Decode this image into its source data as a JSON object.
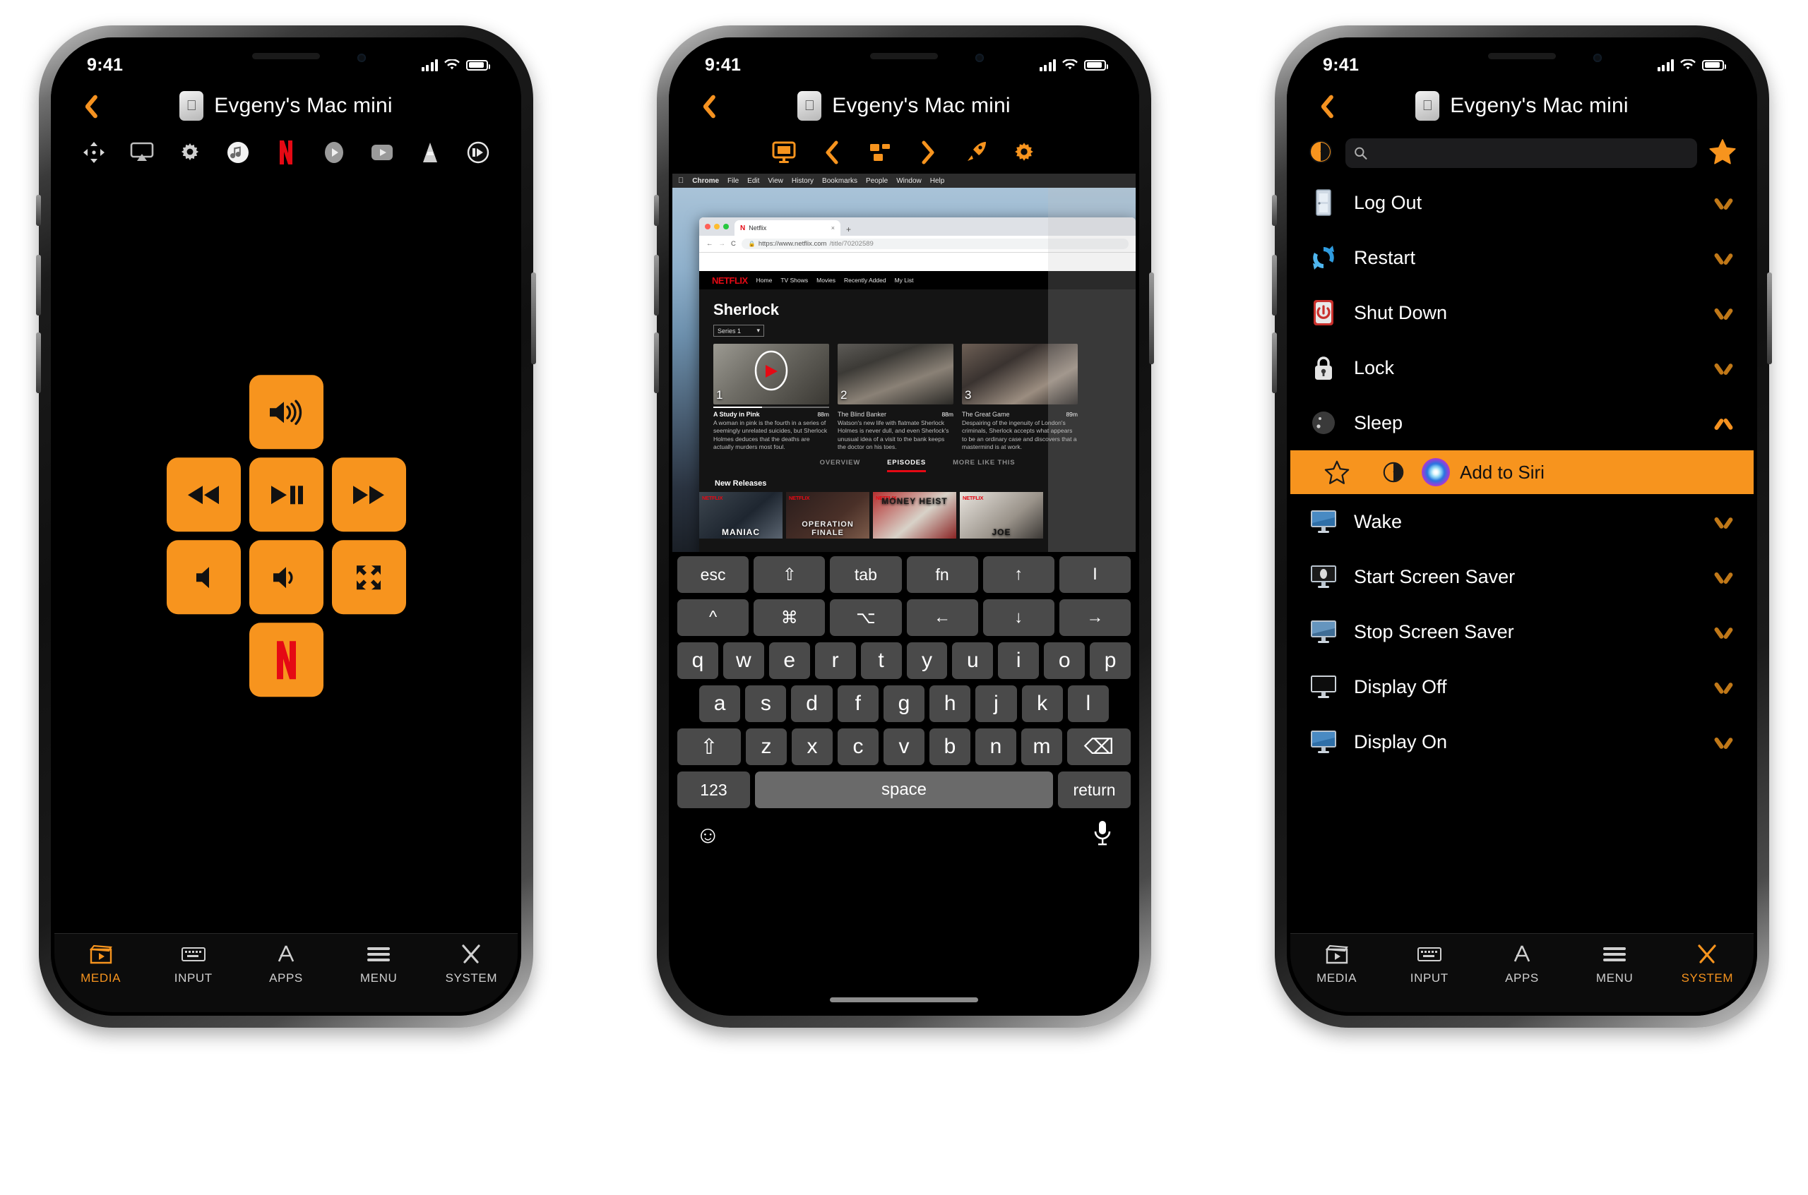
{
  "status": {
    "time": "9:41",
    "signal_bars": 4,
    "wifi": "wifi-icon",
    "battery": "battery-icon"
  },
  "nav": {
    "back": "back-chevron",
    "device_icon": "mac-mini-icon",
    "title": "Evgeny's Mac mini"
  },
  "phone1": {
    "toolbar": [
      {
        "name": "move-cursor-icon",
        "label": "Move"
      },
      {
        "name": "airplay-icon",
        "label": "AirPlay"
      },
      {
        "name": "gear-icon",
        "label": "Settings"
      },
      {
        "name": "itunes-icon",
        "label": "iTunes"
      },
      {
        "name": "netflix-icon",
        "label": "Netflix"
      },
      {
        "name": "quicktime-icon",
        "label": "QuickTime"
      },
      {
        "name": "youtube-icon",
        "label": "YouTube"
      },
      {
        "name": "vlc-icon",
        "label": "VLC"
      },
      {
        "name": "player-icon",
        "label": "Player"
      }
    ],
    "pad": {
      "top": {
        "name": "volume-up-icon",
        "label": "Volume Up"
      },
      "left": {
        "name": "rewind-icon",
        "label": "Rewind"
      },
      "center": {
        "name": "play-pause-icon",
        "label": "Play / Pause"
      },
      "right": {
        "name": "fast-forward-icon",
        "label": "Fast Forward"
      },
      "bottom_left": {
        "name": "mute-icon",
        "label": "Mute"
      },
      "bottom_center": {
        "name": "volume-down-icon",
        "label": "Volume Down"
      },
      "bottom_right": {
        "name": "fullscreen-icon",
        "label": "Full Screen"
      },
      "bottom": {
        "name": "netflix-icon",
        "label": "Netflix"
      }
    }
  },
  "phone2": {
    "toolbar": [
      {
        "name": "display-icon",
        "label": "Display"
      },
      {
        "name": "back-chevron-icon",
        "label": "Back"
      },
      {
        "name": "mission-control-icon",
        "label": "Mission Control"
      },
      {
        "name": "forward-chevron-icon",
        "label": "Forward"
      },
      {
        "name": "launchpad-rocket-icon",
        "label": "Launchpad"
      },
      {
        "name": "gear-icon",
        "label": "Settings"
      }
    ],
    "mac": {
      "menubar": [
        "Chrome",
        "File",
        "Edit",
        "View",
        "History",
        "Bookmarks",
        "People",
        "Window",
        "Help"
      ],
      "browser": {
        "tab_title": "Netflix",
        "tab_close": "×",
        "new_tab": "+",
        "back": "←",
        "forward": "→",
        "reload": "C",
        "url_scheme": "https://www.netflix.com",
        "url_path": "/title/70202589",
        "lock": "lock-icon"
      },
      "netflix": {
        "logo": "NETFLIX",
        "nav": [
          "Home",
          "TV Shows",
          "Movies",
          "Recently Added",
          "My List"
        ],
        "show_title": "Sherlock",
        "series_select": "Series 1",
        "episodes": [
          {
            "num": "1",
            "title": "A Study in Pink",
            "duration": "88m",
            "desc": "A woman in pink is the fourth in a series of seemingly unrelated suicides, but Sherlock Holmes deduces that the deaths are actually murders most foul.",
            "progress": 42
          },
          {
            "num": "2",
            "title": "The Blind Banker",
            "duration": "88m",
            "desc": "Watson's new life with flatmate Sherlock Holmes is never dull, and even Sherlock's unusual idea of a visit to the bank keeps the doctor on his toes.",
            "progress": 0
          },
          {
            "num": "3",
            "title": "The Great Game",
            "duration": "89m",
            "desc": "Despairing of the ingenuity of London's criminals, Sherlock accepts what appears to be an ordinary case and discovers that a mastermind is at work.",
            "progress": 0
          }
        ],
        "tabs": [
          {
            "label": "OVERVIEW",
            "active": false
          },
          {
            "label": "EPISODES",
            "active": true
          },
          {
            "label": "MORE LIKE THIS",
            "active": false
          }
        ],
        "row_title": "New Releases",
        "new_releases": [
          {
            "badge": "NETFLIX",
            "name": "MANIAC"
          },
          {
            "badge": "NETFLIX",
            "name": "OPERATION FINALE"
          },
          {
            "badge": "NETFLIX",
            "name": "MONEY HEIST"
          },
          {
            "badge": "NETFLIX",
            "name": "JOE"
          }
        ]
      }
    },
    "keyboard": {
      "fn_row_1": [
        "esc",
        "⇧",
        "tab",
        "fn",
        "↑",
        "I"
      ],
      "fn_row_2": [
        "^",
        "⌘",
        "⌥",
        "←",
        "↓",
        "→"
      ],
      "row_1": [
        "q",
        "w",
        "e",
        "r",
        "t",
        "y",
        "u",
        "i",
        "o",
        "p"
      ],
      "row_2": [
        "a",
        "s",
        "d",
        "f",
        "g",
        "h",
        "j",
        "k",
        "l"
      ],
      "row_3": [
        "⇧",
        "z",
        "x",
        "c",
        "v",
        "b",
        "n",
        "m",
        "⌫"
      ],
      "row_4": {
        "numbers": "123",
        "space": "space",
        "return": "return"
      },
      "emoji": "emoji-icon",
      "mic": "microphone-icon"
    }
  },
  "phone3": {
    "toolbar": {
      "timer_icon": "timer-icon",
      "star_icon": "star-icon"
    },
    "search": {
      "placeholder": "",
      "value": "",
      "icon": "search-icon"
    },
    "items": [
      {
        "label": "Log Out",
        "icon": "door-icon",
        "expanded": false
      },
      {
        "label": "Restart",
        "icon": "restart-arrows-icon",
        "expanded": false
      },
      {
        "label": "Shut Down",
        "icon": "power-off-icon",
        "expanded": false
      },
      {
        "label": "Lock",
        "icon": "lock-icon",
        "expanded": false
      },
      {
        "label": "Sleep",
        "icon": "moon-icon",
        "expanded": true
      },
      {
        "label": "Wake",
        "icon": "display-blue-icon",
        "expanded": false
      },
      {
        "label": "Start Screen Saver",
        "icon": "screensaver-on-icon",
        "expanded": false
      },
      {
        "label": "Stop Screen Saver",
        "icon": "screensaver-off-icon",
        "expanded": false
      },
      {
        "label": "Display Off",
        "icon": "display-off-icon",
        "expanded": false
      },
      {
        "label": "Display On",
        "icon": "display-on-icon",
        "expanded": false
      }
    ],
    "expanded_actions": {
      "favorite": "star-outline-icon",
      "timer": "timer-outline-icon",
      "siri_icon": "siri-orb-icon",
      "siri_label": "Add to Siri"
    }
  },
  "tabbar": [
    {
      "label": "MEDIA",
      "icon": "clapperboard-icon"
    },
    {
      "label": "INPUT",
      "icon": "keyboard-icon"
    },
    {
      "label": "APPS",
      "icon": "appstore-icon"
    },
    {
      "label": "MENU",
      "icon": "hamburger-icon"
    },
    {
      "label": "SYSTEM",
      "icon": "tools-icon"
    }
  ],
  "tabbar_active": {
    "phone1": "MEDIA",
    "phone2": "INPUT",
    "phone3": "SYSTEM"
  },
  "colors": {
    "accent": "#F7941E",
    "accent_dark": "#C07818",
    "netflix_red": "#E50914",
    "background": "#000000"
  }
}
